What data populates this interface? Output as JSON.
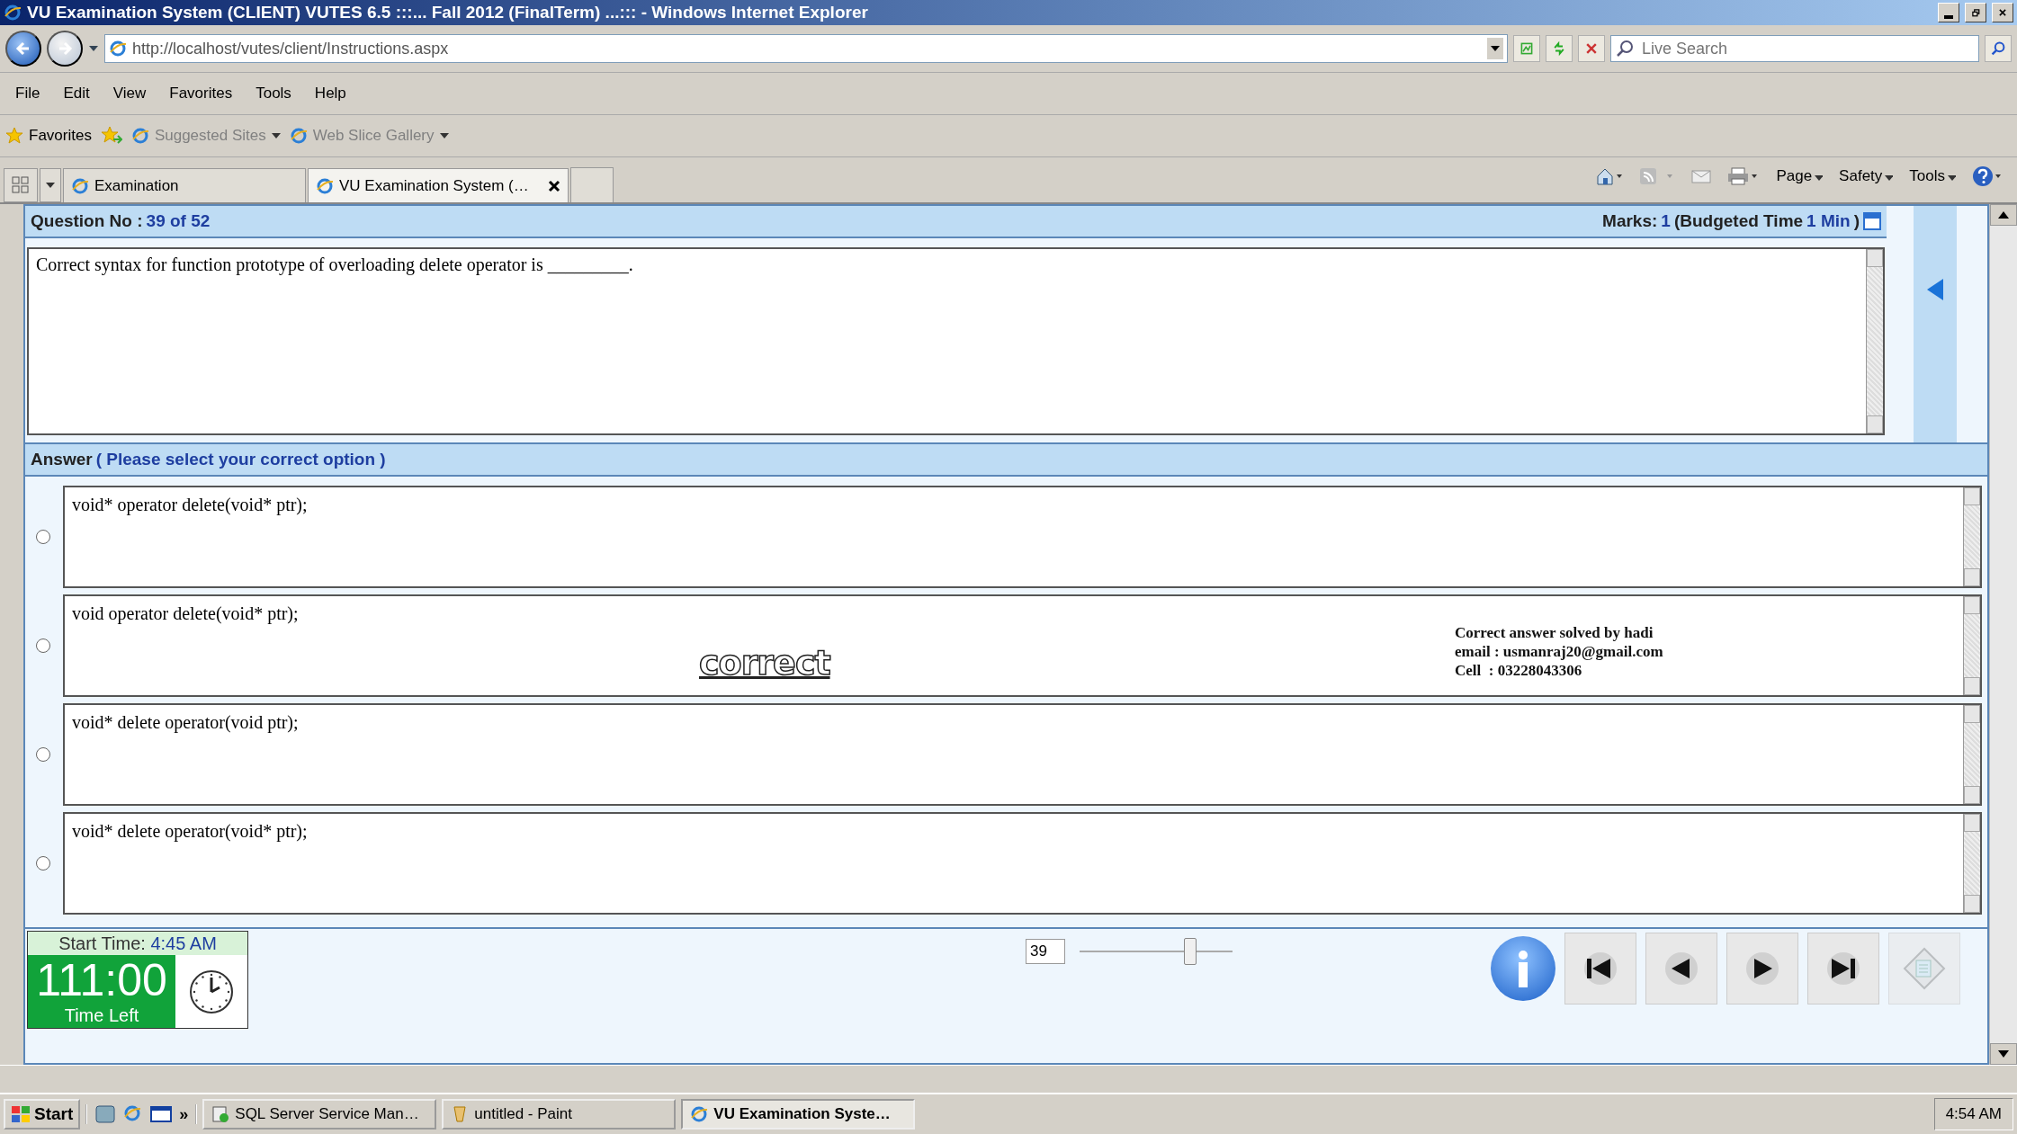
{
  "window": {
    "title": "VU Examination System (CLIENT) VUTES 6.5 :::... Fall 2012 (FinalTerm) ...::: - Windows Internet Explorer"
  },
  "address_bar": {
    "url": "http://localhost/vutes/client/Instructions.aspx"
  },
  "search": {
    "placeholder": "Live Search"
  },
  "menu": [
    "File",
    "Edit",
    "View",
    "Favorites",
    "Tools",
    "Help"
  ],
  "favorites_bar": {
    "label": "Favorites",
    "items": [
      "Suggested Sites",
      "Web Slice Gallery"
    ]
  },
  "tabs": [
    {
      "label": "Examination",
      "selected": false
    },
    {
      "label": "VU Examination System (…",
      "selected": true
    }
  ],
  "command_bar": [
    "Page",
    "Safety",
    "Tools"
  ],
  "question": {
    "label": "Question No :",
    "number": "39 of 52",
    "marks_label": "Marks:",
    "marks": "1",
    "budget_label": "(Budgeted Time",
    "budget": "1 Min",
    "budget_end": ")",
    "text": "Correct syntax for function prototype of overloading delete operator is _________."
  },
  "answer": {
    "label": "Answer",
    "hint": "( Please select your correct option )"
  },
  "options": [
    {
      "text": "void* operator delete(void* ptr);",
      "selected": false
    },
    {
      "text": "void operator delete(void* ptr);",
      "selected": false,
      "stamp": "correct",
      "note": [
        "Correct answer solved by hadi",
        "email : usmanraj20@gmail.com",
        "Cell  : 03228043306"
      ]
    },
    {
      "text": "void* delete operator(void ptr);",
      "selected": false
    },
    {
      "text": "void* delete operator(void* ptr);",
      "selected": false
    }
  ],
  "timer": {
    "start_label": "Start Time:",
    "start": "4:45 AM",
    "remaining": "111:00",
    "remaining_label": "Time Left"
  },
  "navigator": {
    "value": "39",
    "level": 0.72
  },
  "taskbar": {
    "start": "Start",
    "more": "»",
    "tasks": [
      {
        "label": "SQL Server Service Man…",
        "active": false
      },
      {
        "label": "untitled - Paint",
        "active": false
      },
      {
        "label": "VU Examination Syste…",
        "active": true
      }
    ],
    "clock": "4:54 AM"
  }
}
